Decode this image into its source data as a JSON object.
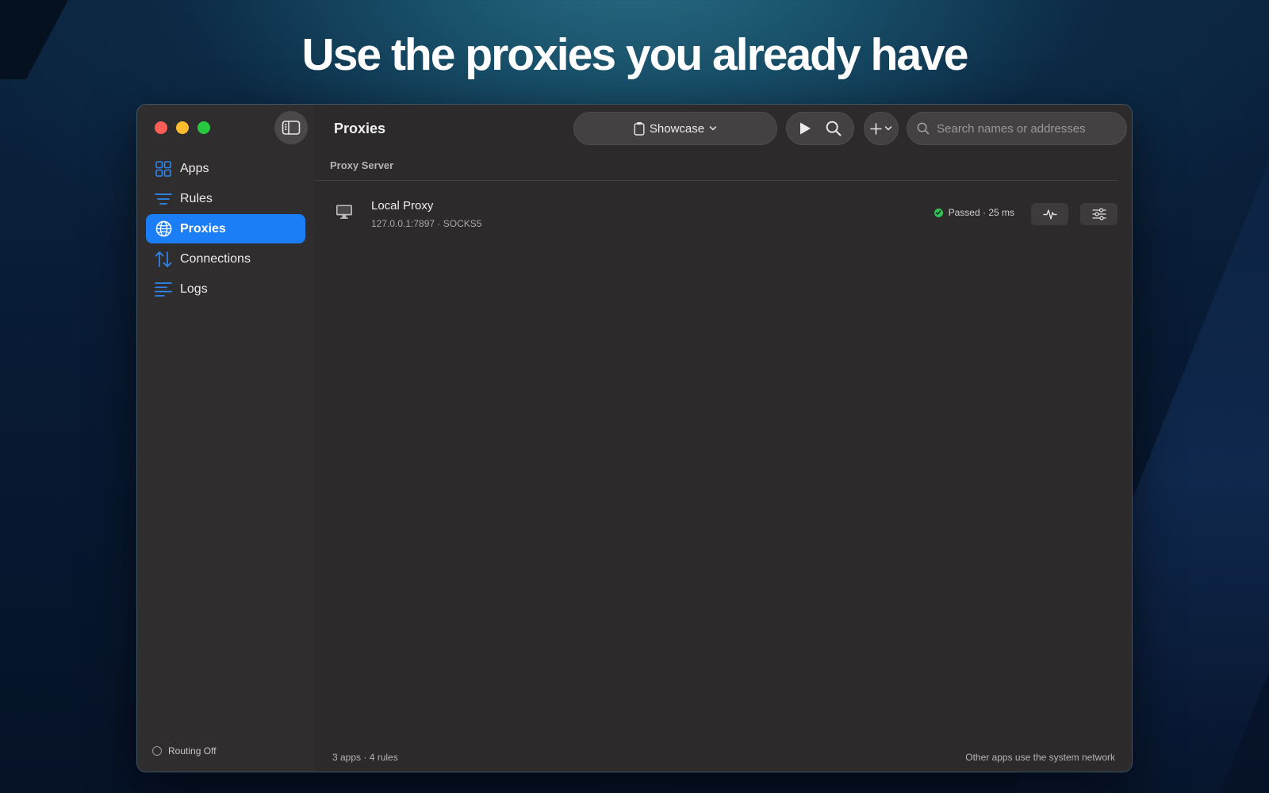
{
  "hero": {
    "title": "Use the proxies you already have"
  },
  "sidebar": {
    "items": [
      {
        "label": "Apps",
        "icon": "grid-icon"
      },
      {
        "label": "Rules",
        "icon": "rules-icon"
      },
      {
        "label": "Proxies",
        "icon": "globe-icon",
        "active": true
      },
      {
        "label": "Connections",
        "icon": "arrows-up-down-icon"
      },
      {
        "label": "Logs",
        "icon": "logs-icon"
      }
    ],
    "routing_status": "Routing Off"
  },
  "toolbar": {
    "title": "Proxies",
    "profile_label": "Showcase",
    "search_placeholder": "Search names or addresses"
  },
  "table": {
    "column_header": "Proxy Server",
    "rows": [
      {
        "name": "Local Proxy",
        "address": "127.0.0.1:7897 · SOCKS5",
        "status": "Passed · 25 ms"
      }
    ]
  },
  "footer": {
    "summary": "3 apps · 4 rules",
    "network_note": "Other apps use the system network"
  },
  "colors": {
    "accent": "#1c7ef6",
    "status_passed": "#32c253",
    "traffic_red": "#ff5f57",
    "traffic_yellow": "#febc2e",
    "traffic_green": "#28c840"
  }
}
